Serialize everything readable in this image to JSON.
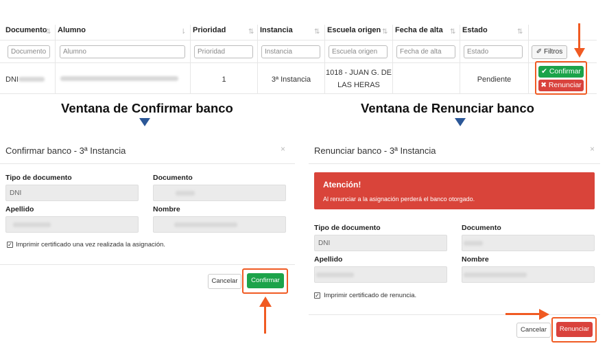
{
  "table": {
    "columns": [
      "Documento",
      "Alumno",
      "Prioridad",
      "Instancia",
      "Escuela origen",
      "Fecha de alta",
      "Estado"
    ],
    "filters": [
      "Documento",
      "Alumno",
      "Prioridad",
      "Instancia",
      "Escuela origen",
      "Fecha de alta",
      "Estado"
    ],
    "filter_button": "Filtros",
    "row": {
      "documento_prefix": "DNI",
      "prioridad": "1",
      "instancia": "3ª Instancia",
      "escuela_line1": "1018 - JUAN G. DE",
      "escuela_line2": "LAS HERAS",
      "estado": "Pendiente",
      "confirm_label": "Confirmar",
      "renunciar_label": "Renunciar"
    }
  },
  "captions": {
    "left": "Ventana de Confirmar banco",
    "right": "Ventana de Renunciar banco"
  },
  "confirm_modal": {
    "title": "Confirmar banco - 3ª Instancia",
    "close": "×",
    "tipo_label": "Tipo de documento",
    "tipo_value": "DNI",
    "documento_label": "Documento",
    "apellido_label": "Apellido",
    "nombre_label": "Nombre",
    "checkbox_label": "Imprimir certificado una vez realizada la asignación.",
    "cancel_label": "Cancelar",
    "submit_label": "Confirmar"
  },
  "renounce_modal": {
    "title": "Renunciar banco - 3ª Instancia",
    "close": "×",
    "alert_title": "Atención!",
    "alert_text": "Al renunciar a la asignación perderá el banco otorgado.",
    "tipo_label": "Tipo de documento",
    "tipo_value": "DNI",
    "documento_label": "Documento",
    "apellido_label": "Apellido",
    "nombre_label": "Nombre",
    "checkbox_label": "Imprimir certificado de renuncia.",
    "cancel_label": "Cancelar",
    "submit_label": "Renunciar"
  },
  "colors": {
    "highlight": "#f05a22",
    "success": "#1ca34a",
    "danger": "#d9423c",
    "pointer": "#2b5797"
  }
}
